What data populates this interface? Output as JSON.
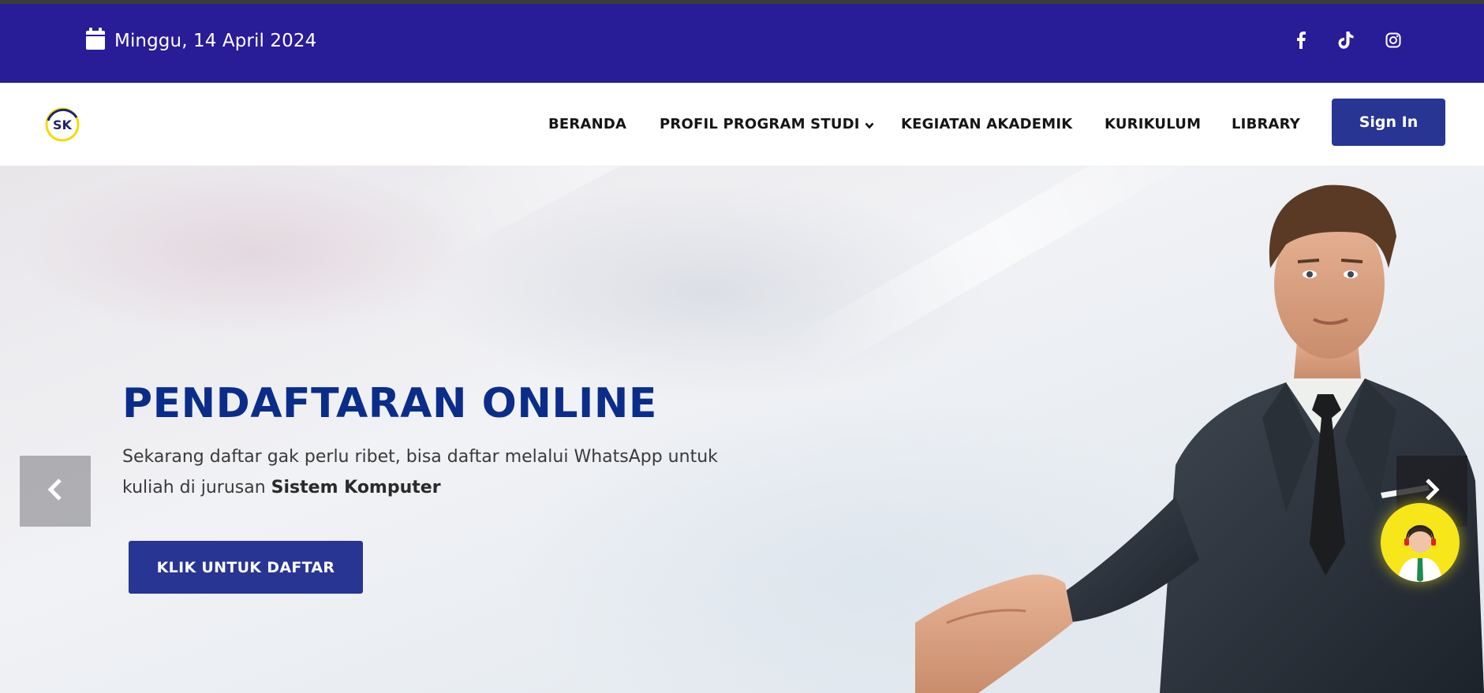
{
  "topbar": {
    "date": "Minggu, 14 April 2024",
    "date_icon": "calendar-icon",
    "social": [
      "facebook-icon",
      "tiktok-icon",
      "instagram-icon"
    ]
  },
  "navbar": {
    "logo_text": "SK",
    "menu": [
      {
        "label": "BERANDA"
      },
      {
        "label": "PROFIL PROGRAM STUDI",
        "dropdown": true
      },
      {
        "label": "KEGIATAN AKADEMIK"
      },
      {
        "label": "KURIKULUM"
      },
      {
        "label": "LIBRARY"
      }
    ],
    "signin_label": "Sign In"
  },
  "hero": {
    "title": "PENDAFTARAN ONLINE",
    "desc_main": "Sekarang daftar gak perlu ribet, bisa daftar melalui WhatsApp untuk kuliah di jurusan ",
    "desc_bold": "Sistem Komputer",
    "cta_label": "KLIK UNTUK DAFTAR"
  },
  "colors": {
    "topbar_bg": "#281c97",
    "primary": "#283593",
    "title": "#0b2d8a",
    "support_bg": "#f6e61a"
  }
}
